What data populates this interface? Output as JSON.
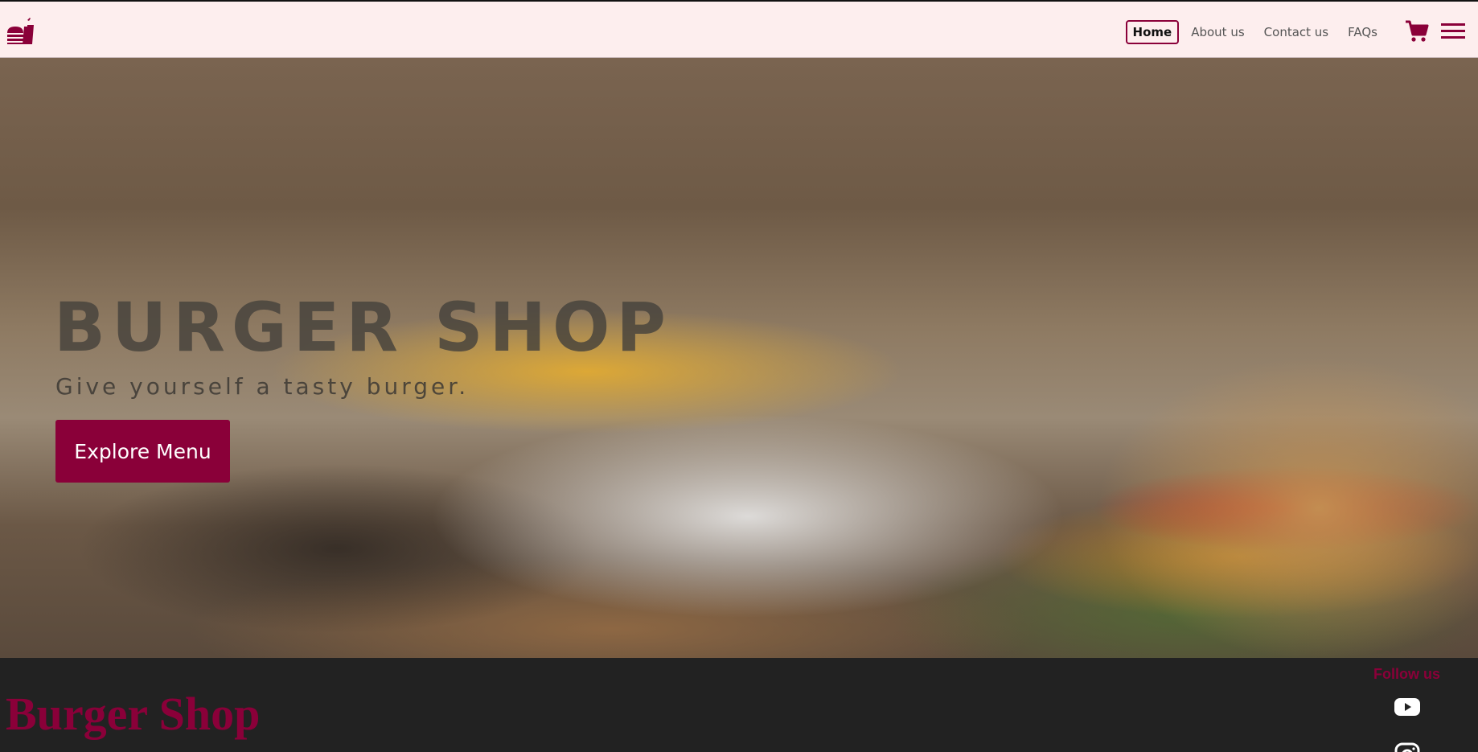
{
  "header": {
    "nav": [
      "Home",
      "About us",
      "Contact us",
      "FAQs"
    ],
    "active": "Home"
  },
  "hero": {
    "title": "BURGER SHOP",
    "subtitle": "Give yourself a tasty burger.",
    "button": "Explore Menu"
  },
  "footer": {
    "brand": "Burger Shop",
    "follow": "Follow us"
  },
  "icons": {
    "logo": "fastfood-icon",
    "cart": "cart-icon",
    "menu": "hamburger-menu-icon",
    "youtube": "youtube-icon",
    "instagram": "instagram-icon"
  },
  "colors": {
    "accent": "#8a0039",
    "header_bg": "#fdeeee",
    "footer_bg": "#222222"
  }
}
